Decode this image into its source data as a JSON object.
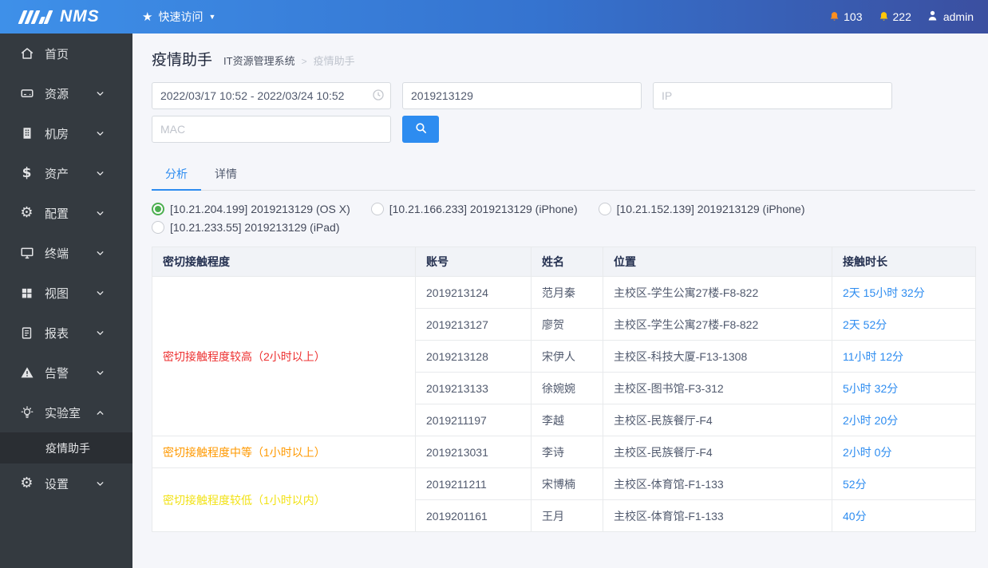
{
  "topbar": {
    "logo_text": "NMS",
    "quick_access": "快速访问",
    "alerts": [
      {
        "count": "103",
        "color": "#ff8f1f"
      },
      {
        "count": "222",
        "color": "#ffc60a"
      }
    ],
    "user": "admin"
  },
  "sidebar": {
    "items": [
      {
        "id": "home",
        "label": "首页",
        "icon": "home-icon"
      },
      {
        "id": "resources",
        "label": "资源",
        "icon": "drive-icon",
        "chevron": "down"
      },
      {
        "id": "server-room",
        "label": "机房",
        "icon": "building-icon",
        "chevron": "down"
      },
      {
        "id": "assets",
        "label": "资产",
        "icon": "dollar-icon",
        "chevron": "down"
      },
      {
        "id": "config",
        "label": "配置",
        "icon": "gear-icon",
        "chevron": "down"
      },
      {
        "id": "terminal",
        "label": "终端",
        "icon": "monitor-icon",
        "chevron": "down"
      },
      {
        "id": "views",
        "label": "视图",
        "icon": "grid-icon",
        "chevron": "down"
      },
      {
        "id": "reports",
        "label": "报表",
        "icon": "report-icon",
        "chevron": "down"
      },
      {
        "id": "alerts",
        "label": "告警",
        "icon": "warning-icon",
        "chevron": "down"
      },
      {
        "id": "lab",
        "label": "实验室",
        "icon": "bulb-icon",
        "chevron": "up",
        "children": [
          {
            "id": "epidemic-assistant",
            "label": "疫情助手",
            "active": true
          }
        ]
      },
      {
        "id": "settings",
        "label": "设置",
        "icon": "gear-icon",
        "chevron": "down"
      }
    ]
  },
  "page": {
    "title": "疫情助手",
    "breadcrumb_root": "IT资源管理系统",
    "breadcrumb_sep": ">",
    "breadcrumb_current": "疫情助手"
  },
  "search": {
    "date_range_value": "2022/03/17 10:52 - 2022/03/24 10:52",
    "account_value": "2019213129",
    "ip_placeholder": "IP",
    "mac_placeholder": "MAC"
  },
  "tabs": [
    {
      "id": "analysis",
      "label": "分析",
      "active": true
    },
    {
      "id": "detail",
      "label": "详情",
      "active": false
    }
  ],
  "devices": [
    {
      "label": "[10.21.204.199] 2019213129 (OS X)",
      "selected": true
    },
    {
      "label": "[10.21.166.233] 2019213129 (iPhone)",
      "selected": false
    },
    {
      "label": "[10.21.152.139] 2019213129 (iPhone)",
      "selected": false
    },
    {
      "label": "[10.21.233.55] 2019213129 (iPad)",
      "selected": false
    }
  ],
  "table": {
    "headers": [
      "密切接触程度",
      "账号",
      "姓名",
      "位置",
      "接触时长"
    ],
    "groups": [
      {
        "label": "密切接触程度较高（2小时以上）",
        "color": "#ed3030",
        "rows": [
          [
            "2019213124",
            "范月秦",
            "主校区-学生公寓27楼-F8-822",
            "2天 15小时 32分"
          ],
          [
            "2019213127",
            "廖贺",
            "主校区-学生公寓27楼-F8-822",
            "2天 52分"
          ],
          [
            "2019213128",
            "宋伊人",
            "主校区-科技大厦-F13-1308",
            "11小时 12分"
          ],
          [
            "2019213133",
            "徐婉婉",
            "主校区-图书馆-F3-312",
            "5小时 32分"
          ],
          [
            "2019211197",
            "李越",
            "主校区-民族餐厅-F4",
            "2小时 20分"
          ]
        ]
      },
      {
        "label": "密切接触程度中等（1小时以上）",
        "color": "#ff9900",
        "rows": [
          [
            "2019213031",
            "李诗",
            "主校区-民族餐厅-F4",
            "2小时 0分"
          ]
        ]
      },
      {
        "label": "密切接触程度较低（1小时以内）",
        "color": "#f2e215",
        "rows": [
          [
            "2019211211",
            "宋博楠",
            "主校区-体育馆-F1-133",
            "52分"
          ],
          [
            "2019201161",
            "王月",
            "主校区-体育馆-F1-133",
            "40分"
          ]
        ]
      }
    ]
  },
  "colors": {
    "accent_blue": "#2d8cf0",
    "radio_selected_green": "#4caf50",
    "topbar_gradient_left": "#3e90e9",
    "topbar_gradient_right": "#3b4fa0",
    "sidebar_bg": "#343a40"
  }
}
